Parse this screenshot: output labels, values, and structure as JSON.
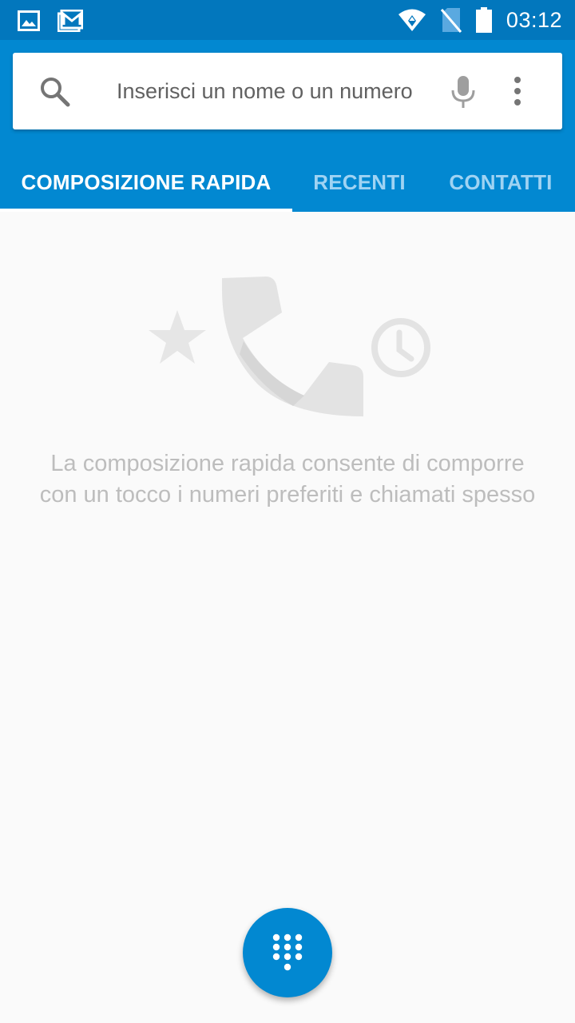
{
  "status_bar": {
    "time": "03:12",
    "icons": [
      "image-notification-icon",
      "email-notification-icon",
      "wifi-icon",
      "no-sim-icon",
      "battery-icon"
    ]
  },
  "search": {
    "placeholder": "Inserisci un nome o un numero",
    "value": ""
  },
  "tabs": [
    {
      "label": "COMPOSIZIONE RAPIDA",
      "active": true
    },
    {
      "label": "RECENTI",
      "active": false
    },
    {
      "label": "CONTATTI",
      "active": false
    }
  ],
  "empty_state": {
    "message": "La composizione rapida consente di comporre con un tocco i numeri preferiti e chiamati spesso"
  },
  "colors": {
    "status_bar": "#0277bd",
    "app_bar": "#0288d1",
    "tab_inactive": "#9fd3f3",
    "background": "#fafafa",
    "empty_text": "#bdbdbd",
    "fab": "#0288d1"
  }
}
